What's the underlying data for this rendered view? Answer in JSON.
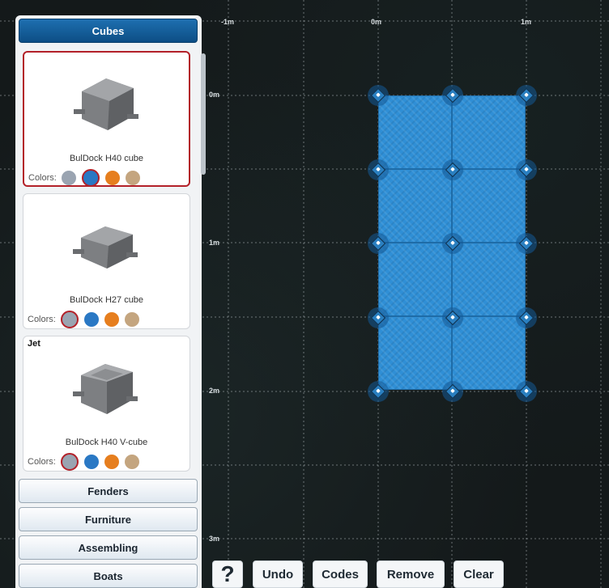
{
  "panel": {
    "active_category": "Cubes",
    "products": [
      {
        "badge": "",
        "name": "BulDock H40 cube",
        "colors_label": "Colors:",
        "selected": true,
        "selected_color": 1
      },
      {
        "badge": "",
        "name": "BulDock H27 cube",
        "colors_label": "Colors:",
        "selected": false,
        "selected_color": 0
      },
      {
        "badge": "Jet",
        "name": "BulDock H40 V-cube",
        "colors_label": "Colors:",
        "selected": false,
        "selected_color": 0
      }
    ],
    "swatch_colors": [
      "#9aa4b1",
      "#2a78c4",
      "#e67e1e",
      "#c4a57f"
    ],
    "categories": [
      "Fenders",
      "Furniture",
      "Assembling",
      "Boats"
    ]
  },
  "toolbar": {
    "help_label": "?",
    "undo_label": "Undo",
    "codes_label": "Codes",
    "remove_label": "Remove",
    "clear_label": "Clear"
  },
  "canvas": {
    "x_scale": [
      "-1m",
      "0m",
      "1m"
    ],
    "y_scale": [
      "0m",
      "1m",
      "2m",
      "3m"
    ],
    "dock_color": "#2f8fd6",
    "dock_cubes_cols": 2,
    "dock_cubes_rows": 4
  }
}
